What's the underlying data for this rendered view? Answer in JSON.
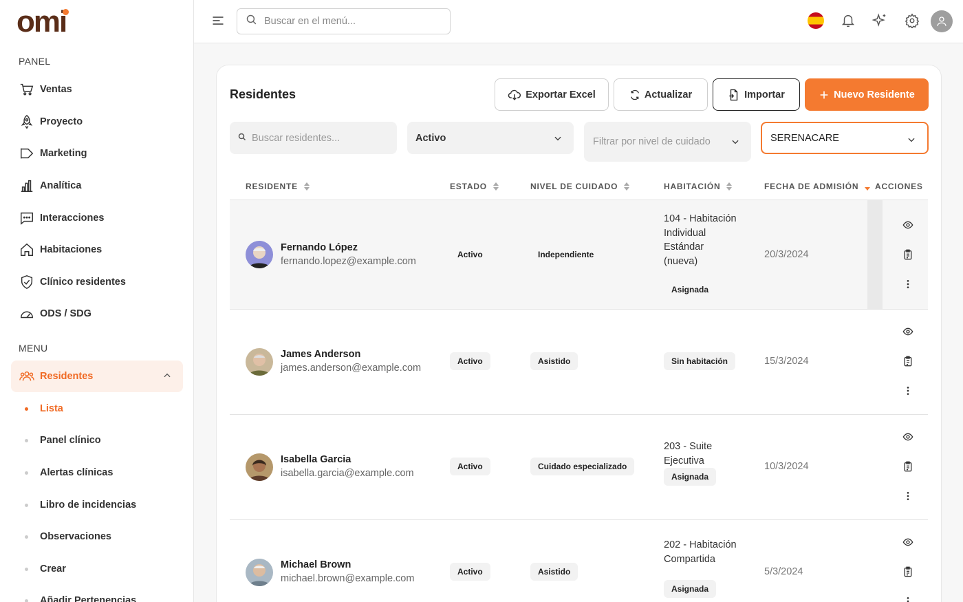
{
  "brand": {
    "logo": "omi"
  },
  "sidebar": {
    "panel_label": "PANEL",
    "panel_items": [
      {
        "label": "Ventas",
        "icon": "cart-icon"
      },
      {
        "label": "Proyecto",
        "icon": "rocket-icon"
      },
      {
        "label": "Marketing",
        "icon": "megaphone-icon"
      },
      {
        "label": "Analítica",
        "icon": "bar-chart-icon"
      },
      {
        "label": "Interacciones",
        "icon": "chat-icon"
      },
      {
        "label": "Habitaciones",
        "icon": "home-icon"
      },
      {
        "label": "Clínico residentes",
        "icon": "shield-check-icon"
      },
      {
        "label": "ODS / SDG",
        "icon": "gauge-icon"
      }
    ],
    "menu_label": "MENU",
    "active_item": {
      "label": "Residentes",
      "icon": "users-icon"
    },
    "sub_items": [
      {
        "label": "Lista"
      },
      {
        "label": "Panel clínico"
      },
      {
        "label": "Alertas clínicas"
      },
      {
        "label": "Libro de incidencias"
      },
      {
        "label": "Observaciones"
      },
      {
        "label": "Crear"
      },
      {
        "label": "Añadir Pertenencias"
      }
    ]
  },
  "header": {
    "search_placeholder": "Buscar en el menú..."
  },
  "page": {
    "title": "Residentes",
    "buttons": {
      "export": "Exportar Excel",
      "refresh": "Actualizar",
      "import": "Importar",
      "new": "Nuevo Residente"
    },
    "filters": {
      "search_placeholder": "Buscar residentes...",
      "status_value": "Activo",
      "care_placeholder": "Filtrar por nivel de cuidado",
      "facility_value": "SERENACARE"
    },
    "columns": [
      "RESIDENTE",
      "ESTADO",
      "NIVEL DE CUIDADO",
      "HABITACIÓN",
      "FECHA DE ADMISIÓN",
      "ACCIONES"
    ],
    "rows": [
      {
        "name": "Fernando López",
        "email": "fernando.lopez@example.com",
        "status": "Activo",
        "care": "Independiente",
        "room": "104 - Habitación Individual Estándar (nueva)",
        "room_status": "Asignada",
        "date": "20/3/2024"
      },
      {
        "name": "James Anderson",
        "email": "james.anderson@example.com",
        "status": "Activo",
        "care": "Asistido",
        "room": "",
        "room_status": "Sin habitación",
        "date": "15/3/2024"
      },
      {
        "name": "Isabella Garcia",
        "email": "isabella.garcia@example.com",
        "status": "Activo",
        "care": "Cuidado especializado",
        "room": "203 - Suite Ejecutiva",
        "room_status": "Asignada",
        "date": "10/3/2024"
      },
      {
        "name": "Michael Brown",
        "email": "michael.brown@example.com",
        "status": "Activo",
        "care": "Asistido",
        "room": "202 - Habitación Compartida",
        "room_status": "Asignada",
        "date": "5/3/2024"
      }
    ]
  },
  "colors": {
    "accent": "#f47a30",
    "brand": "#5a2d18",
    "active_bg": "#fdf0e9"
  }
}
